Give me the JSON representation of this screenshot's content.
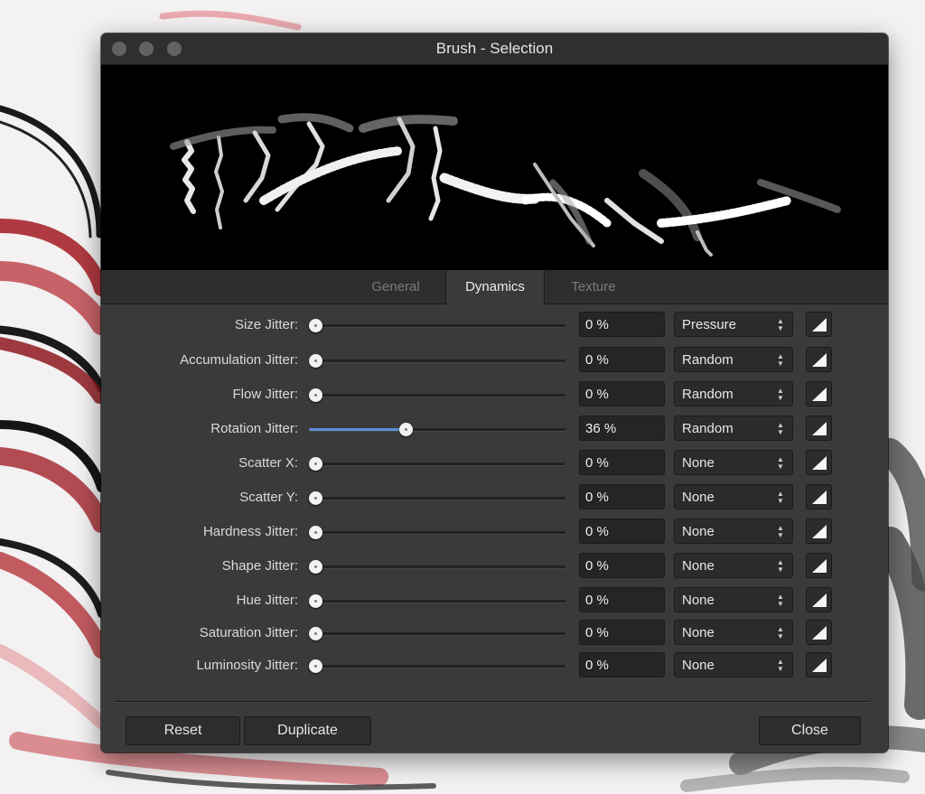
{
  "window": {
    "title": "Brush - Selection"
  },
  "tabs": [
    {
      "label": "General",
      "active": false
    },
    {
      "label": "Dynamics",
      "active": true
    },
    {
      "label": "Texture",
      "active": false
    }
  ],
  "rows": [
    {
      "label": "Size Jitter:",
      "value": "0 %",
      "level": 0,
      "controller": "Pressure"
    },
    {
      "label": "Accumulation Jitter:",
      "value": "0 %",
      "level": 0,
      "controller": "Random"
    },
    {
      "label": "Flow Jitter:",
      "value": "0 %",
      "level": 0,
      "controller": "Random"
    },
    {
      "label": "Rotation Jitter:",
      "value": "36 %",
      "level": 36,
      "controller": "Random"
    },
    {
      "label": "Scatter X:",
      "value": "0 %",
      "level": 0,
      "controller": "None"
    },
    {
      "label": "Scatter Y:",
      "value": "0 %",
      "level": 0,
      "controller": "None"
    },
    {
      "label": "Hardness Jitter:",
      "value": "0 %",
      "level": 0,
      "controller": "None"
    },
    {
      "label": "Shape Jitter:",
      "value": "0 %",
      "level": 0,
      "controller": "None"
    },
    {
      "label": "Hue Jitter:",
      "value": "0 %",
      "level": 0,
      "controller": "None"
    },
    {
      "label": "Saturation Jitter:",
      "value": "0 %",
      "level": 0,
      "controller": "None"
    },
    {
      "label": "Luminosity Jitter:",
      "value": "0 %",
      "level": 0,
      "controller": "None"
    }
  ],
  "buttons": {
    "reset": "Reset",
    "duplicate": "Duplicate",
    "close": "Close"
  },
  "icons": {
    "controller_stepper": "up-down-arrows-icon",
    "response_curve": "response-curve-icon"
  },
  "colors": {
    "accent": "#5b8fd4",
    "window": "#3a3a3a",
    "preview": "#000000"
  }
}
